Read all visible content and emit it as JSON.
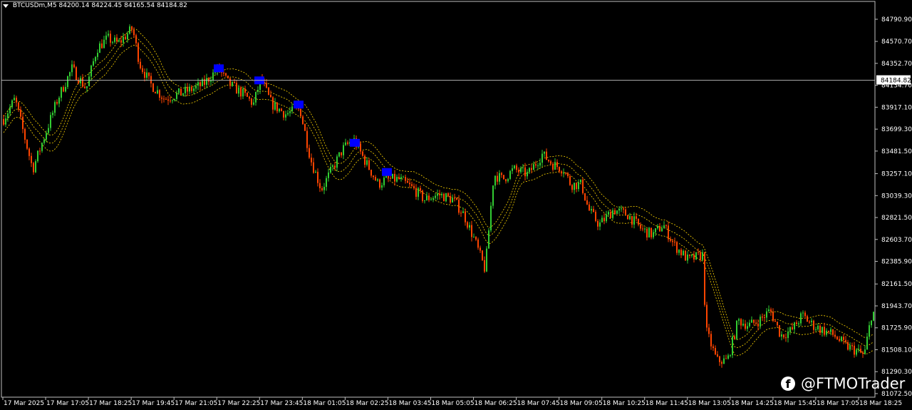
{
  "header": {
    "symbol": "BTCUSDm,M5",
    "ohlc": "84200.14 84224.45 84165.54 84184.82"
  },
  "watermark": {
    "icon": "facebook-icon",
    "text": "@FTMOTrader"
  },
  "colors": {
    "background": "#000000",
    "bull": "#32cd32",
    "bear": "#ff4500",
    "band": "#ffd700",
    "signal": "#0000ff",
    "axis": "#c0c0c0"
  },
  "chart_data": {
    "type": "candlestick",
    "symbol": "BTCUSDm",
    "timeframe": "M5",
    "current_price": "84184.82",
    "y_ticks": [
      "84790.90",
      "84570.70",
      "84352.70",
      "84134.70",
      "83917.10",
      "83699.30",
      "83481.50",
      "83257.10",
      "83039.30",
      "82821.50",
      "82603.70",
      "82385.90",
      "82161.50",
      "81943.70",
      "81725.90",
      "81508.10",
      "81290.30",
      "81072.50"
    ],
    "y_range": [
      81072.5,
      84790.9
    ],
    "x_ticks": [
      "17 Mar 2025",
      "17 Mar 17:05",
      "17 Mar 18:25",
      "17 Mar 19:45",
      "17 Mar 21:05",
      "17 Mar 22:25",
      "17 Mar 23:45",
      "18 Mar 01:05",
      "18 Mar 02:25",
      "18 Mar 03:45",
      "18 Mar 05:05",
      "18 Mar 06:25",
      "18 Mar 07:45",
      "18 Mar 09:05",
      "18 Mar 10:25",
      "18 Mar 11:45",
      "18 Mar 13:05",
      "18 Mar 14:25",
      "18 Mar 15:45",
      "18 Mar 17:05",
      "18 Mar 18:25"
    ],
    "price_path": [
      [
        0,
        83750
      ],
      [
        20,
        84000
      ],
      [
        45,
        83300
      ],
      [
        60,
        83600
      ],
      [
        80,
        84000
      ],
      [
        100,
        84300
      ],
      [
        120,
        84100
      ],
      [
        135,
        84500
      ],
      [
        150,
        84600
      ],
      [
        165,
        84550
      ],
      [
        185,
        84700
      ],
      [
        195,
        84350
      ],
      [
        210,
        84150
      ],
      [
        230,
        84000
      ],
      [
        250,
        84050
      ],
      [
        270,
        84100
      ],
      [
        285,
        84150
      ],
      [
        305,
        84300
      ],
      [
        320,
        84150
      ],
      [
        340,
        84050
      ],
      [
        355,
        83950
      ],
      [
        365,
        84200
      ],
      [
        380,
        83950
      ],
      [
        400,
        83850
      ],
      [
        420,
        83900
      ],
      [
        435,
        83400
      ],
      [
        450,
        83100
      ],
      [
        465,
        83300
      ],
      [
        480,
        83500
      ],
      [
        495,
        83600
      ],
      [
        510,
        83400
      ],
      [
        530,
        83150
      ],
      [
        540,
        83200
      ],
      [
        560,
        83200
      ],
      [
        580,
        83100
      ],
      [
        595,
        83000
      ],
      [
        615,
        83050
      ],
      [
        635,
        83000
      ],
      [
        650,
        82850
      ],
      [
        665,
        82600
      ],
      [
        680,
        82300
      ],
      [
        692,
        83250
      ],
      [
        705,
        83200
      ],
      [
        720,
        83300
      ],
      [
        740,
        83250
      ],
      [
        760,
        83450
      ],
      [
        775,
        83350
      ],
      [
        790,
        83300
      ],
      [
        800,
        83150
      ],
      [
        815,
        83150
      ],
      [
        825,
        82900
      ],
      [
        840,
        82750
      ],
      [
        860,
        82900
      ],
      [
        880,
        82850
      ],
      [
        900,
        82700
      ],
      [
        915,
        82650
      ],
      [
        930,
        82750
      ],
      [
        945,
        82550
      ],
      [
        965,
        82400
      ],
      [
        985,
        82450
      ],
      [
        990,
        81700
      ],
      [
        1005,
        81400
      ],
      [
        1020,
        81400
      ],
      [
        1035,
        81800
      ],
      [
        1050,
        81750
      ],
      [
        1065,
        81800
      ],
      [
        1080,
        81900
      ],
      [
        1095,
        81650
      ],
      [
        1110,
        81700
      ],
      [
        1125,
        81850
      ],
      [
        1140,
        81750
      ],
      [
        1155,
        81700
      ],
      [
        1170,
        81650
      ],
      [
        1185,
        81550
      ],
      [
        1200,
        81500
      ],
      [
        1212,
        81450
      ],
      [
        1222,
        81850
      ],
      [
        1228,
        81900
      ]
    ],
    "signal_prices": [
      "84300",
      "84180",
      "83940",
      "83560",
      "83270"
    ],
    "watermark": "@FTMOTrader"
  }
}
